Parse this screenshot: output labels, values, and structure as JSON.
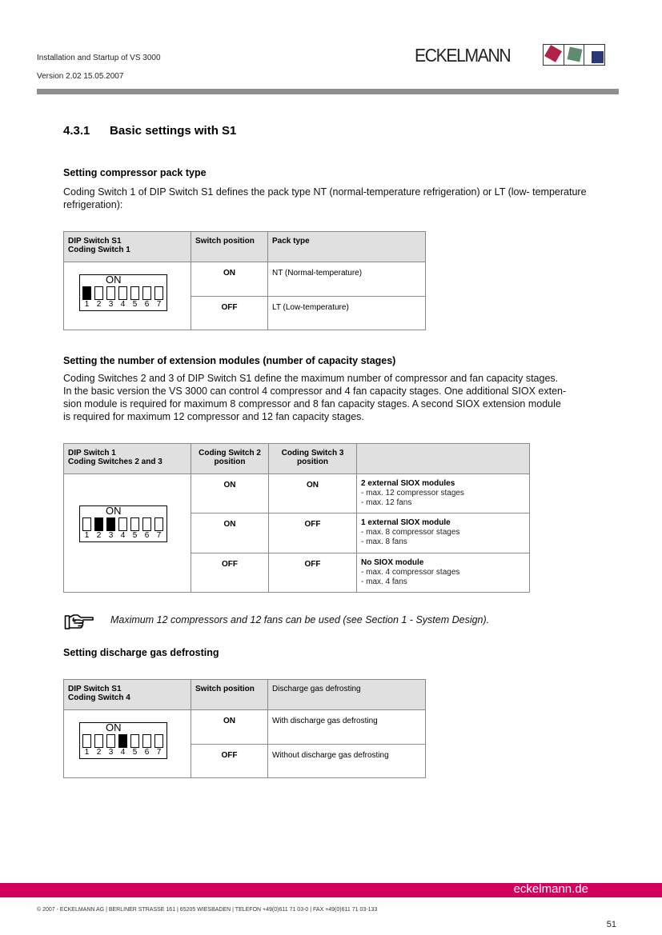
{
  "header": {
    "doc_title": "Installation and Startup of VS 3000",
    "version": "Version 2.02   15.05.2007",
    "logo_text": "ECKELMANN",
    "logo_colors": {
      "red": "#b0224a",
      "green": "#5e8c6e",
      "blue": "#2b3878"
    }
  },
  "section": {
    "number": "4.3.1",
    "title": "Basic settings with S1"
  },
  "pack_type": {
    "heading": "Setting compressor pack type",
    "paragraph": "Coding Switch 1 of  DIP Switch S1 defines the pack type NT (normal-temperature refrigeration) or LT (low- temperature refrigeration):",
    "table": {
      "headers": [
        "DIP Switch S1",
        "Coding Switch 1",
        "Switch position",
        "Pack type"
      ],
      "dip": {
        "label": "ON",
        "numbers": [
          "1",
          "2",
          "3",
          "4",
          "5",
          "6",
          "7"
        ],
        "active": [
          1
        ]
      },
      "rows": [
        {
          "position": "ON",
          "value": "NT (Normal-temperature)"
        },
        {
          "position": "OFF",
          "value": "LT (Low-temperature)"
        }
      ]
    }
  },
  "extension": {
    "heading": "Setting the number of extension modules (number of capacity stages)",
    "paragraph_lines": [
      "Coding Switches 2 and 3 of  DIP Switch S1 define the maximum number of compressor and fan capacity stages.",
      "In the basic version the VS 3000 can control 4 compressor and 4 fan capacity stages. One additional SIOX exten-",
      "sion module is required for maximum 8 compressor and 8 fan capacity stages. A second SIOX extension module",
      "is required for maximum 12 compressor and 12 fan capacity stages."
    ],
    "table": {
      "headers": [
        "DIP Switch 1",
        "Coding Switches 2 and 3",
        "Coding Switch 2",
        "position",
        "Coding Switch 3",
        "position",
        ""
      ],
      "dip": {
        "label": "ON",
        "numbers": [
          "1",
          "2",
          "3",
          "4",
          "5",
          "6",
          "7"
        ],
        "active": [
          2,
          3
        ]
      },
      "rows": [
        {
          "sw2": "ON",
          "sw3": "ON",
          "title": "2 external SIOX modules",
          "lines": [
            "- max. 12 compressor stages",
            "- max. 12 fans"
          ]
        },
        {
          "sw2": "ON",
          "sw3": "OFF",
          "title": "1 external SIOX module",
          "lines": [
            "- max. 8 compressor stages",
            "- max. 8 fans"
          ]
        },
        {
          "sw2": "OFF",
          "sw3": "OFF",
          "title": "No SIOX module",
          "lines": [
            "- max. 4 compressor stages",
            "- max. 4 fans"
          ]
        }
      ]
    }
  },
  "note": {
    "icon": "pointing-hand-icon",
    "text": "Maximum 12 compressors and 12 fans can be used (see Section 1 - System Design)."
  },
  "defrost": {
    "heading": "Setting discharge gas defrosting",
    "table": {
      "headers": [
        "DIP Switch S1",
        "Coding Switch 4",
        "Switch position",
        "Discharge gas defrosting"
      ],
      "dip": {
        "label": "ON",
        "numbers": [
          "1",
          "2",
          "3",
          "4",
          "5",
          "6",
          "7"
        ],
        "active": [
          4
        ]
      },
      "rows": [
        {
          "position": "ON",
          "value": "With discharge gas defrosting"
        },
        {
          "position": "OFF",
          "value": "Without discharge gas defrosting"
        }
      ]
    }
  },
  "footer": {
    "site": "eckelmann.de",
    "copyright": "© 2007 - ECKELMANN AG | BERLINER STRASSE 161 | 65205 WIESBADEN | TELEFON +49(0)611 71 03-0 | FAX +49(0)611 71 03-133",
    "page_number": "51",
    "bar_color": "#d1005d"
  }
}
